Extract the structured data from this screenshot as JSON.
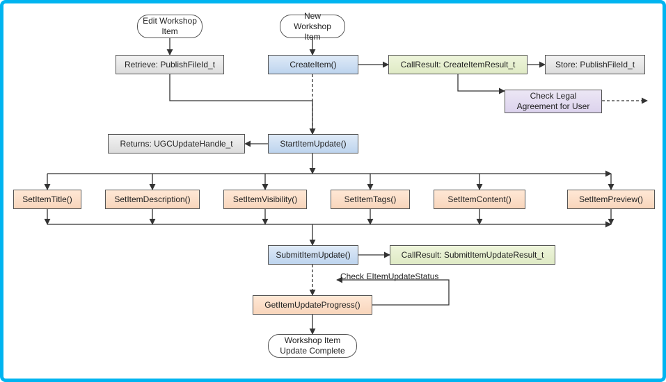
{
  "terminator": {
    "edit": "Edit Workshop Item",
    "new": "New Workshop Item",
    "done": "Workshop Item Update Complete"
  },
  "box": {
    "retrieve": "Retrieve: PublishFileId_t",
    "createItem": "CreateItem()",
    "crCreateItem": "CallResult: CreateItemResult_t",
    "store": "Store: PublishFileId_t",
    "checkLegal": "Check Legal Agreement for User",
    "returnsHandle": "Returns: UGCUpdateHandle_t",
    "startUpdate": "StartItemUpdate()",
    "setTitle": "SetItemTitle()",
    "setDesc": "SetItemDescription()",
    "setVis": "SetItemVisibility()",
    "setTags": "SetItemTags()",
    "setContent": "SetItemContent()",
    "setPreview": "SetItemPreview()",
    "submitUpdate": "SubmitItemUpdate()",
    "crSubmit": "CallResult: SubmitItemUpdateResult_t",
    "getProgress": "GetItemUpdateProgress()"
  },
  "edgeLabel": {
    "checkStatus": "Check EItemUpdateStatus"
  },
  "chart_data": {
    "type": "flowchart",
    "nodes": [
      {
        "id": "edit",
        "kind": "terminator",
        "label": "Edit Workshop Item"
      },
      {
        "id": "new",
        "kind": "terminator",
        "label": "New Workshop Item"
      },
      {
        "id": "retrieve",
        "kind": "process",
        "label": "Retrieve: PublishFileId_t"
      },
      {
        "id": "createItem",
        "kind": "process",
        "label": "CreateItem()"
      },
      {
        "id": "crCreate",
        "kind": "result",
        "label": "CallResult: CreateItemResult_t"
      },
      {
        "id": "store",
        "kind": "process",
        "label": "Store: PublishFileId_t"
      },
      {
        "id": "checkLegal",
        "kind": "process",
        "label": "Check Legal Agreement for User"
      },
      {
        "id": "returnsH",
        "kind": "process",
        "label": "Returns: UGCUpdateHandle_t"
      },
      {
        "id": "startUpd",
        "kind": "process",
        "label": "StartItemUpdate()"
      },
      {
        "id": "setTitle",
        "kind": "process",
        "label": "SetItemTitle()"
      },
      {
        "id": "setDesc",
        "kind": "process",
        "label": "SetItemDescription()"
      },
      {
        "id": "setVis",
        "kind": "process",
        "label": "SetItemVisibility()"
      },
      {
        "id": "setTags",
        "kind": "process",
        "label": "SetItemTags()"
      },
      {
        "id": "setContent",
        "kind": "process",
        "label": "SetItemContent()"
      },
      {
        "id": "setPreview",
        "kind": "process",
        "label": "SetItemPreview()"
      },
      {
        "id": "submitUpd",
        "kind": "process",
        "label": "SubmitItemUpdate()"
      },
      {
        "id": "crSubmit",
        "kind": "result",
        "label": "CallResult: SubmitItemUpdateResult_t"
      },
      {
        "id": "getProg",
        "kind": "process",
        "label": "GetItemUpdateProgress()"
      },
      {
        "id": "done",
        "kind": "terminator",
        "label": "Workshop Item Update Complete"
      }
    ],
    "edges": [
      {
        "from": "edit",
        "to": "retrieve"
      },
      {
        "from": "new",
        "to": "createItem"
      },
      {
        "from": "createItem",
        "to": "crCreate"
      },
      {
        "from": "crCreate",
        "to": "store"
      },
      {
        "from": "crCreate",
        "to": "checkLegal"
      },
      {
        "from": "checkLegal",
        "to": "(external)",
        "style": "dashed"
      },
      {
        "from": "retrieve",
        "to": "startUpd"
      },
      {
        "from": "createItem",
        "to": "startUpd",
        "style": "dashed"
      },
      {
        "from": "startUpd",
        "to": "returnsH"
      },
      {
        "from": "startUpd",
        "to": "setTitle"
      },
      {
        "from": "startUpd",
        "to": "setDesc"
      },
      {
        "from": "startUpd",
        "to": "setVis"
      },
      {
        "from": "startUpd",
        "to": "setTags"
      },
      {
        "from": "startUpd",
        "to": "setContent"
      },
      {
        "from": "startUpd",
        "to": "setPreview"
      },
      {
        "from": "setTitle",
        "to": "submitUpd"
      },
      {
        "from": "setDesc",
        "to": "submitUpd"
      },
      {
        "from": "setVis",
        "to": "submitUpd"
      },
      {
        "from": "setTags",
        "to": "submitUpd"
      },
      {
        "from": "setContent",
        "to": "submitUpd"
      },
      {
        "from": "setPreview",
        "to": "submitUpd"
      },
      {
        "from": "submitUpd",
        "to": "crSubmit"
      },
      {
        "from": "submitUpd",
        "to": "getProg",
        "style": "dashed"
      },
      {
        "from": "getProg",
        "to": "submitUpd",
        "label": "Check EItemUpdateStatus"
      },
      {
        "from": "getProg",
        "to": "done"
      }
    ]
  }
}
